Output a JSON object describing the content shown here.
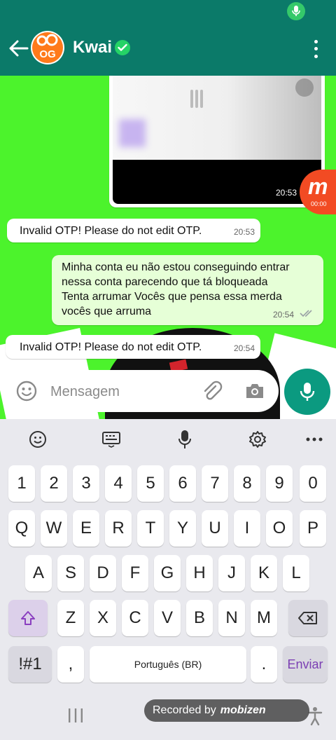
{
  "header": {
    "contact_name": "Kwai",
    "avatar_text": "OG"
  },
  "media": {
    "time": "20:53",
    "recorder_timer": "00:00"
  },
  "messages": [
    {
      "direction": "in",
      "text": "Invalid OTP! Please do not edit OTP.",
      "time": "20:53"
    },
    {
      "direction": "out",
      "text": "Minha conta eu não estou conseguindo entrar nessa conta parecendo que tá bloqueada Tenta arrumar Vocês que pensa essa merda vocês que arruma",
      "time": "20:54",
      "status": "read"
    },
    {
      "direction": "in",
      "text": "Invalid OTP! Please do not edit OTP.",
      "time": "20:54"
    }
  ],
  "composer": {
    "placeholder": "Mensagem"
  },
  "keyboard": {
    "row_numbers": [
      "1",
      "2",
      "3",
      "4",
      "5",
      "6",
      "7",
      "8",
      "9",
      "0"
    ],
    "row1": [
      "Q",
      "W",
      "E",
      "R",
      "T",
      "Y",
      "U",
      "I",
      "O",
      "P"
    ],
    "row2": [
      "A",
      "S",
      "D",
      "F",
      "G",
      "H",
      "J",
      "K",
      "L"
    ],
    "row3": [
      "Z",
      "X",
      "C",
      "V",
      "B",
      "N",
      "M"
    ],
    "symbols_label": "!#1",
    "comma": ",",
    "space_label": "Português (BR)",
    "period": ".",
    "enter_label": "Enviar"
  },
  "overlay": {
    "recorded_by": "Recorded by",
    "brand": "mobizen"
  },
  "colors": {
    "header": "#0b7a69",
    "chat_bg": "#4cf32c",
    "outgoing_bubble": "#e6ffd7",
    "fab": "#0b9a80",
    "enter_text": "#7b3fb3"
  }
}
